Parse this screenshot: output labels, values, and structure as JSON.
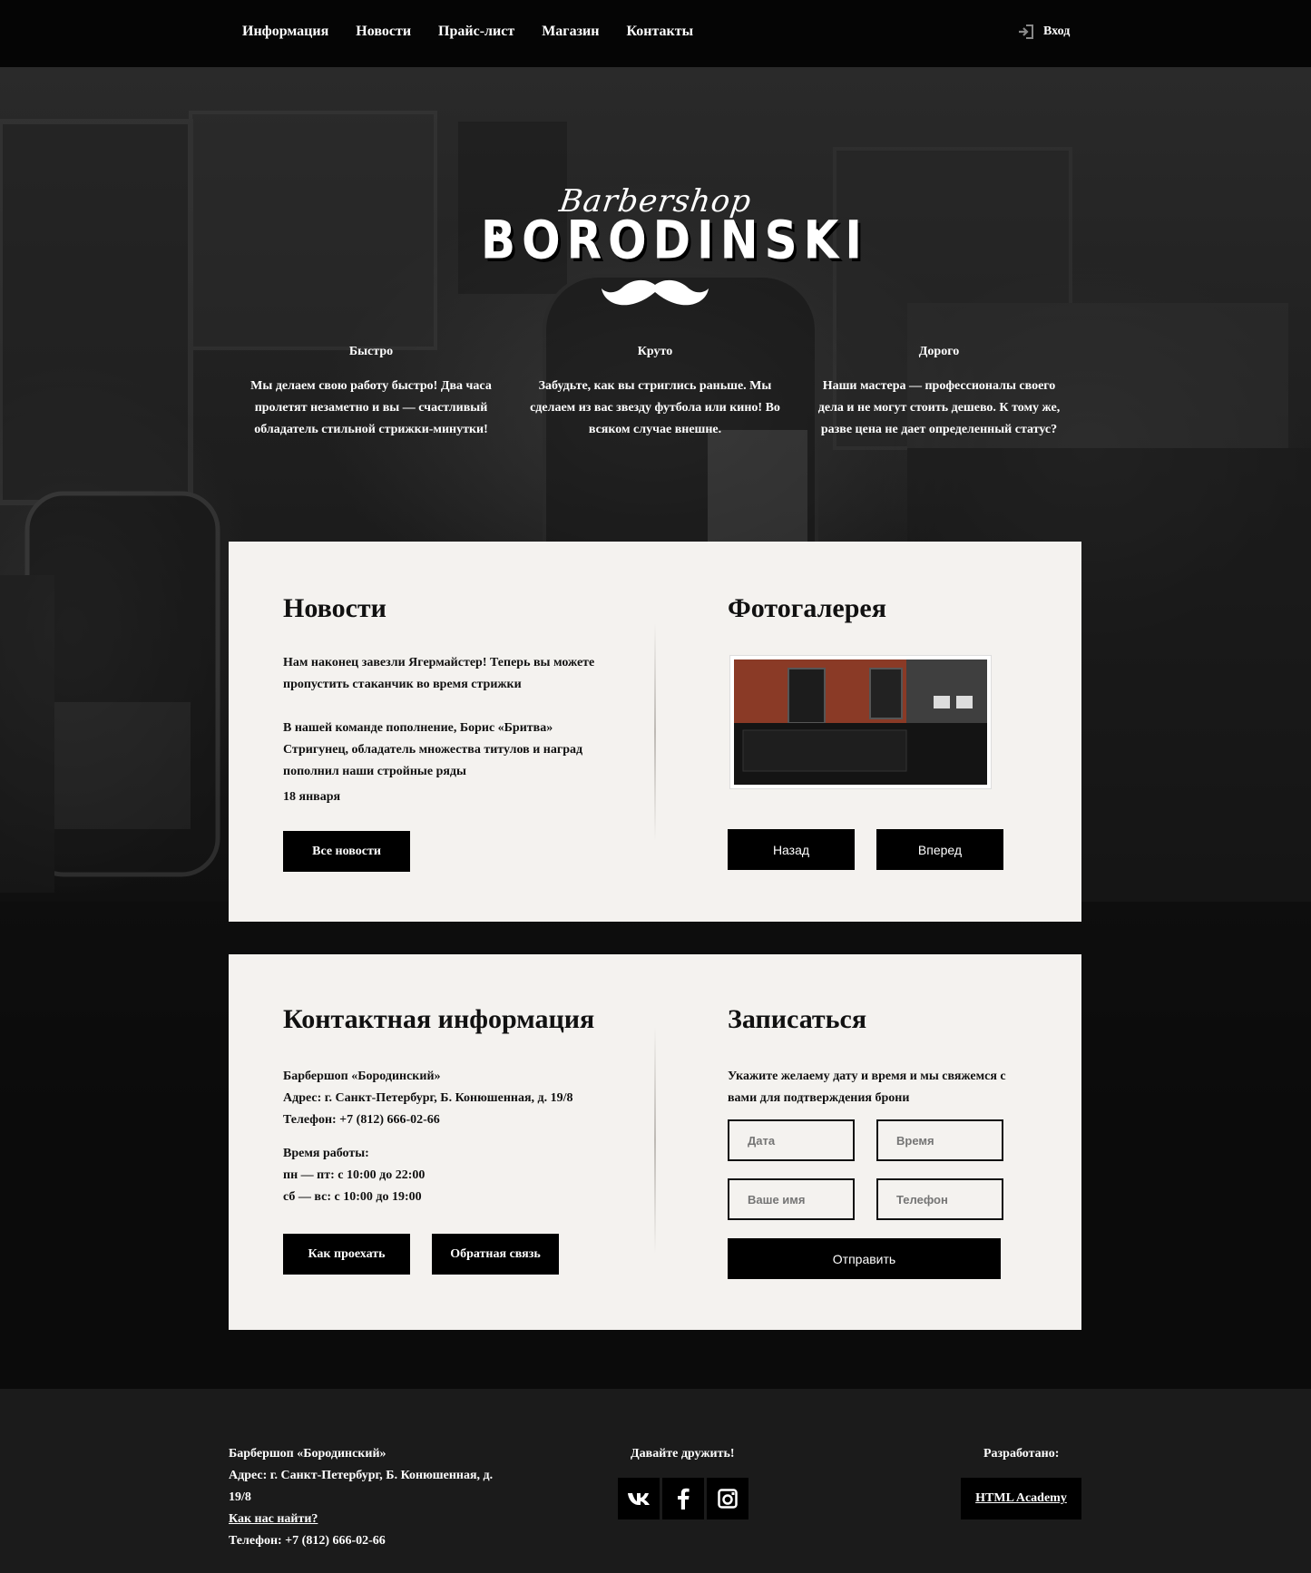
{
  "header": {
    "nav": [
      "Информация",
      "Новости",
      "Прайс-лист",
      "Магазин",
      "Контакты"
    ],
    "login_label": "Вход"
  },
  "logo": {
    "script": "Barbershop",
    "main": "BORODINSKI"
  },
  "features": [
    {
      "title": "Быстро",
      "text": "Мы делаем свою работу быстро! Два часа пролетят незаметно и вы — счастливый обладатель стильной стрижки-минутки!"
    },
    {
      "title": "Круто",
      "text": "Забудьте, как вы стриглись раньше. Мы сделаем из вас звезду футбола или кино! Во всяком случае внешне."
    },
    {
      "title": "Дорого",
      "text": "Наши мастера — профессионалы своего дела и не могут стоить дешево. К тому же, разве цена не дает определенный статус?"
    }
  ],
  "news": {
    "title": "Новости",
    "items": [
      "Нам наконец завезли Ягермайстер! Теперь вы можете пропустить стаканчик во время стрижки",
      "В нашей команде пополнение, Борис «Бритва» Стригунец, обладатель множества титулов и наград пополнил наши стройные ряды"
    ],
    "date": "18 января",
    "all_button": "Все новости"
  },
  "gallery": {
    "title": "Фотогалерея",
    "prev": "Назад",
    "next": "Вперед"
  },
  "contacts": {
    "title": "Контактная информация",
    "name": "Барбершоп «Бородинский»",
    "address": "Адрес: г. Санкт-Петербург, Б. Конюшенная, д. 19/8",
    "phone": "Телефон: +7 (812) 666-02-66",
    "hours_title": "Время работы:",
    "hours_weekdays": "пн — пт: с 10:00 до 22:00",
    "hours_weekend": "сб — вс: с 10:00 до 19:00",
    "route_button": "Как проехать",
    "feedback_button": "Обратная связь"
  },
  "booking": {
    "title": "Записаться",
    "desc": "Укажите желаему дату и время и мы свяжемся с вами для подтверждения брони",
    "date_placeholder": "Дата",
    "time_placeholder": "Время",
    "name_placeholder": "Ваше имя",
    "phone_placeholder": "Телефон",
    "submit": "Отправить"
  },
  "footer": {
    "name": "Барбершоп «Бородинский»",
    "address": "Адрес: г. Санкт-Петербург, Б. Конюшенная, д. 19/8",
    "find_link": "Как нас найти?",
    "phone": "Телефон: +7 (812) 666-02-66",
    "social_title": "Давайте дружить!",
    "dev_title": "Разработано:",
    "dev_name": "HTML Academy"
  }
}
